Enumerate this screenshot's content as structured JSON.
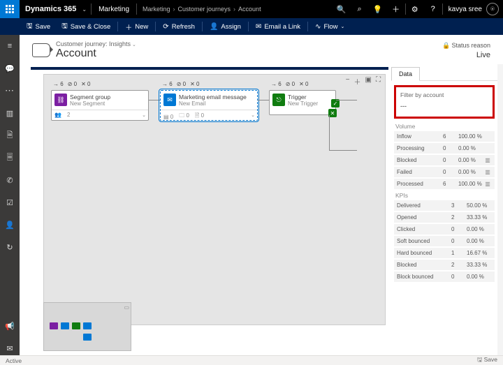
{
  "topbar": {
    "brand": "Dynamics 365",
    "area": "Marketing",
    "crumbs": [
      "Marketing",
      "Customer journeys",
      "Account"
    ],
    "user": "kavya sree"
  },
  "cmd": {
    "save": "Save",
    "save_close": "Save & Close",
    "new": "New",
    "refresh": "Refresh",
    "assign": "Assign",
    "email_link": "Email a Link",
    "flow": "Flow"
  },
  "header": {
    "context": "Customer journey: Insights",
    "title": "Account",
    "status_label": "Status reason",
    "status_value": "Live"
  },
  "tiles": {
    "segment": {
      "stats": {
        "arrow": "6",
        "stop": "0",
        "x": "0"
      },
      "title": "Segment group",
      "subtitle": "New Segment",
      "foot_people": "2"
    },
    "email": {
      "stats": {
        "arrow": "6",
        "stop": "0",
        "x": "0"
      },
      "title": "Marketing email message",
      "subtitle": "New Email",
      "foot": {
        "a": "0",
        "b": "0",
        "c": "0"
      }
    },
    "trigger": {
      "stats": {
        "arrow": "6",
        "stop": "0",
        "x": "0"
      },
      "title": "Trigger",
      "subtitle": "New Trigger"
    }
  },
  "panel": {
    "tab": "Data",
    "filter_label": "Filter by account",
    "filter_value": "---",
    "volume_title": "Volume",
    "volume": [
      {
        "label": "Inflow",
        "count": "6",
        "pct": "100.00 %"
      },
      {
        "label": "Processing",
        "count": "0",
        "pct": "0.00 %"
      },
      {
        "label": "Blocked",
        "count": "0",
        "pct": "0.00 %"
      },
      {
        "label": "Failed",
        "count": "0",
        "pct": "0.00 %"
      },
      {
        "label": "Processed",
        "count": "6",
        "pct": "100.00 %"
      }
    ],
    "kpi_title": "KPIs",
    "kpis": [
      {
        "label": "Delivered",
        "count": "3",
        "pct": "50.00 %"
      },
      {
        "label": "Opened",
        "count": "2",
        "pct": "33.33 %"
      },
      {
        "label": "Clicked",
        "count": "0",
        "pct": "0.00 %"
      },
      {
        "label": "Soft bounced",
        "count": "0",
        "pct": "0.00 %"
      },
      {
        "label": "Hard bounced",
        "count": "1",
        "pct": "16.67 %"
      },
      {
        "label": "Blocked",
        "count": "2",
        "pct": "33.33 %"
      },
      {
        "label": "Block bounced",
        "count": "0",
        "pct": "0.00 %"
      }
    ]
  },
  "statusbar": {
    "left": "Active",
    "right": "Save"
  }
}
